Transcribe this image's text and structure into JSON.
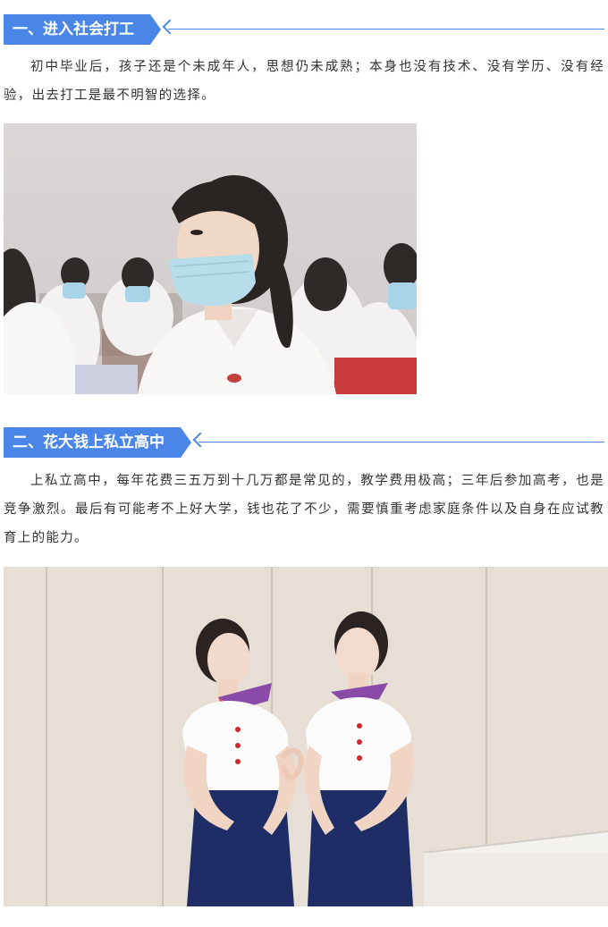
{
  "sections": [
    {
      "heading": "一、进入社会打工",
      "paragraph": "初中毕业后，孩子还是个未成年人，思想仍未成熟；本身也没有技术、没有学历、没有经验，出去打工是最不明智的选择。",
      "image_icon": "classroom-students-photo"
    },
    {
      "heading": "二、花大钱上私立高中",
      "paragraph": "上私立高中，每年花费三五万到十几万都是常见的，教学费用极高；三年后参加高考，也是竞争激烈。最后有可能考不上好大学，钱也花了不少，需要慎重考虑家庭条件以及自身在应试教育上的能力。",
      "image_icon": "two-uniformed-students-photo"
    }
  ],
  "colors": {
    "accent": "#4a86e8",
    "text": "#333333"
  }
}
